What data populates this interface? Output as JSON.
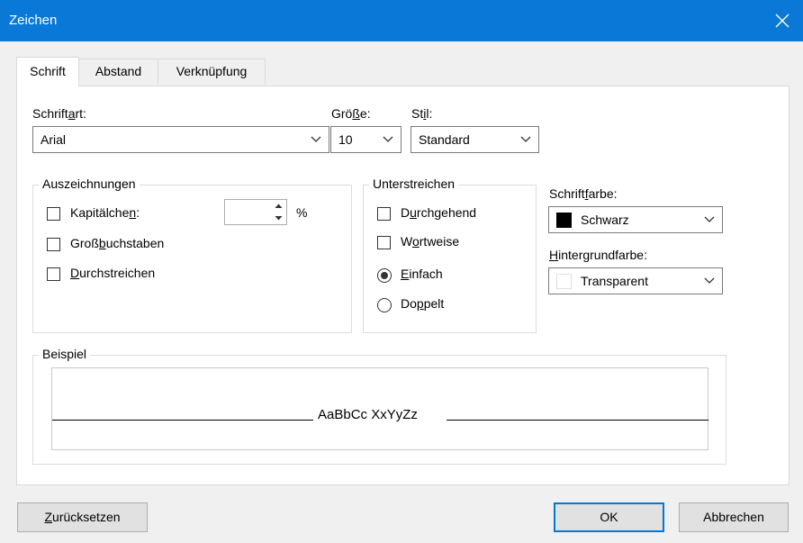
{
  "window": {
    "title": "Zeichen"
  },
  "tabs": [
    {
      "label": "Schrift",
      "active": true
    },
    {
      "label": "Abstand",
      "active": false
    },
    {
      "label": "Verknüpfung",
      "active": false
    }
  ],
  "font": {
    "family_label_pre": "Schrift",
    "family_label_u": "a",
    "family_label_post": "rt:",
    "family_value": "Arial",
    "size_label_pre": "Grö",
    "size_label_u": "ß",
    "size_label_post": "e:",
    "size_value": "10",
    "style_label_pre": "St",
    "style_label_u": "i",
    "style_label_post": "l:",
    "style_value": "Standard"
  },
  "auszeichnungen": {
    "title": "Auszeichnungen",
    "kapitaelchen_pre": "Kapitälche",
    "kapitaelchen_u": "n",
    "kapitaelchen_post": ":",
    "kapitaelchen_checked": false,
    "percent_value": "",
    "percent_sign": "%",
    "gross_pre": "Groß",
    "gross_u": "b",
    "gross_post": "uchstaben",
    "gross_checked": false,
    "durch_pre": "",
    "durch_u": "D",
    "durch_post": "urchstreichen",
    "durch_checked": false
  },
  "unterstreichen": {
    "title": "Unterstreichen",
    "durchgehend_pre": "D",
    "durchgehend_u": "u",
    "durchgehend_post": "rchgehend",
    "durchgehend_checked": false,
    "wortweise_pre": "W",
    "wortweise_u": "o",
    "wortweise_post": "rtweise",
    "wortweise_checked": false,
    "einfach_pre": "",
    "einfach_u": "E",
    "einfach_post": "infach",
    "einfach_selected": true,
    "doppelt_pre": "Do",
    "doppelt_u": "p",
    "doppelt_post": "pelt",
    "doppelt_selected": false
  },
  "colors": {
    "font_color_label_pre": "Schrift",
    "font_color_label_u": "f",
    "font_color_label_post": "arbe:",
    "font_color_value": "Schwarz",
    "font_color_swatch": "#000000",
    "bg_color_label_pre": "",
    "bg_color_label_u": "H",
    "bg_color_label_post": "intergrundfarbe:",
    "bg_color_value": "Transparent",
    "bg_color_swatch": "#ffffff"
  },
  "preview": {
    "title": "Beispiel",
    "sample_text": "AaBbCc XxYyZz"
  },
  "buttons": {
    "reset_pre": "",
    "reset_u": "Z",
    "reset_post": "urücksetzen",
    "ok": "OK",
    "cancel": "Abbrechen"
  },
  "accent": "#0a78d7"
}
